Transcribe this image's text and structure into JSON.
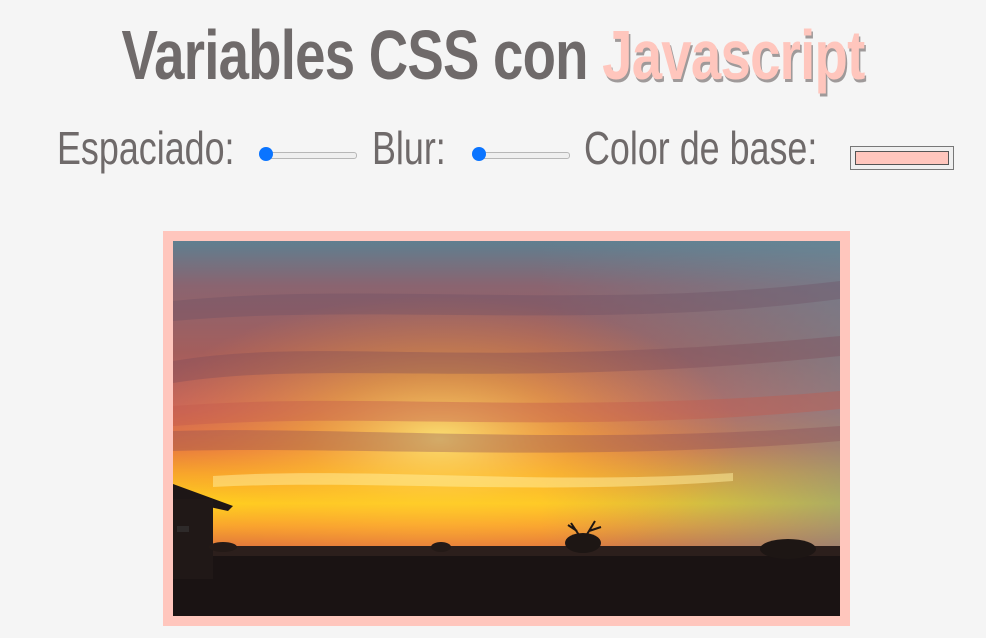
{
  "header": {
    "title_plain": "Variables CSS con",
    "title_accent": "Javascript"
  },
  "controls": {
    "spacing_label": "Espaciado:",
    "spacing_value": 0,
    "blur_label": "Blur:",
    "blur_value": 0,
    "base_color_label": "Color de base:",
    "base_color": "#ffc6bd"
  },
  "colors": {
    "text": "#6f6a6a",
    "accent": "#ffc6bd",
    "slider": "#0a74ff",
    "background": "#f5f5f5"
  },
  "image": {
    "description_icon": "sunset-photo"
  }
}
